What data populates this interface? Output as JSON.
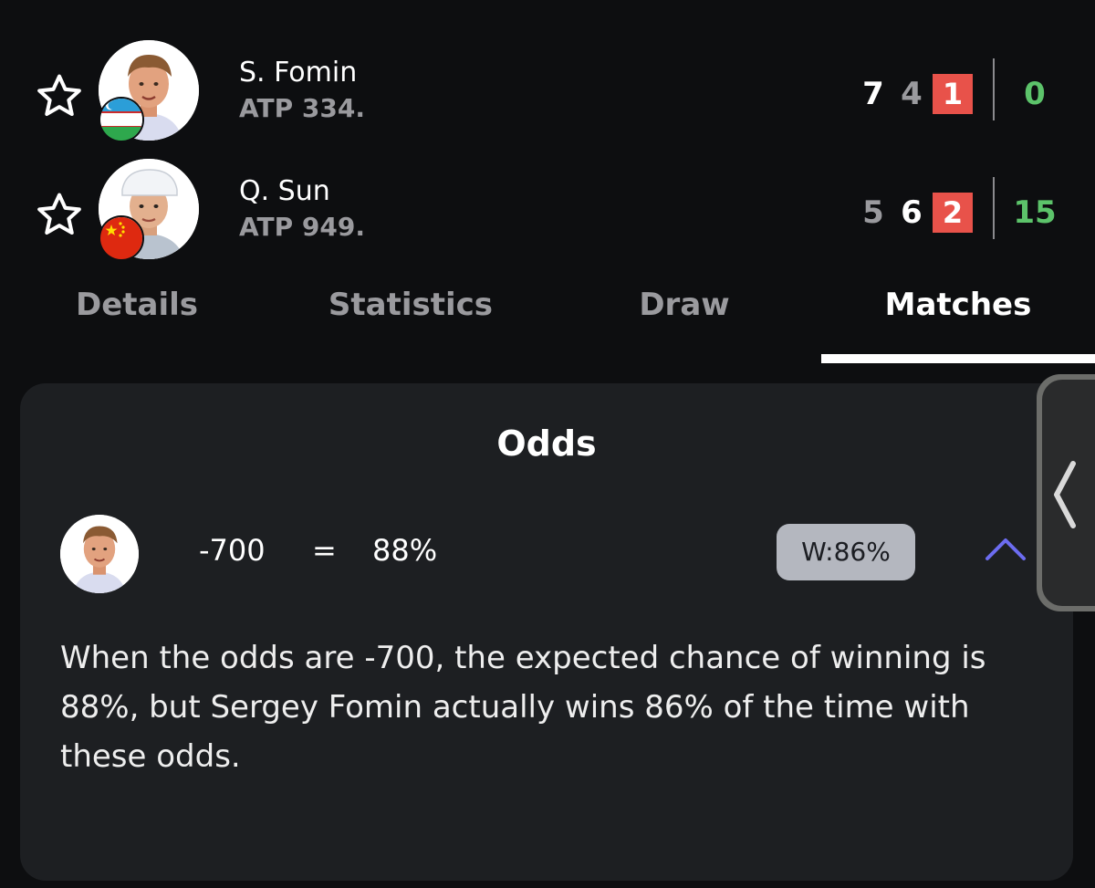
{
  "players": [
    {
      "name": "S. Fomin",
      "rank": "ATP 334.",
      "flag": "uzbekistan-flag-icon",
      "sets": [
        "7",
        "4",
        "1"
      ],
      "game": "0"
    },
    {
      "name": "Q. Sun",
      "rank": "ATP 949.",
      "flag": "china-flag-icon",
      "sets": [
        "5",
        "6",
        "2"
      ],
      "game": "15"
    }
  ],
  "tabs": [
    {
      "label": "Details"
    },
    {
      "label": "Statistics"
    },
    {
      "label": "Draw"
    },
    {
      "label": "Matches",
      "active": true
    }
  ],
  "odds": {
    "title": "Odds",
    "value": "-700",
    "equals": "=",
    "implied": "88%",
    "badge": "W:86%",
    "description": "When the odds are -700, the expected chance of winning is 88%, but Sergey Fomin actually wins 86% of the time with these odds."
  },
  "colors": {
    "background": "#0d0e10",
    "card": "#1d1f22",
    "current_set": "#e8524a",
    "game_score": "#5cc36a",
    "accent_chevron": "#6c6cf0",
    "badge": "#b4b7bf"
  }
}
